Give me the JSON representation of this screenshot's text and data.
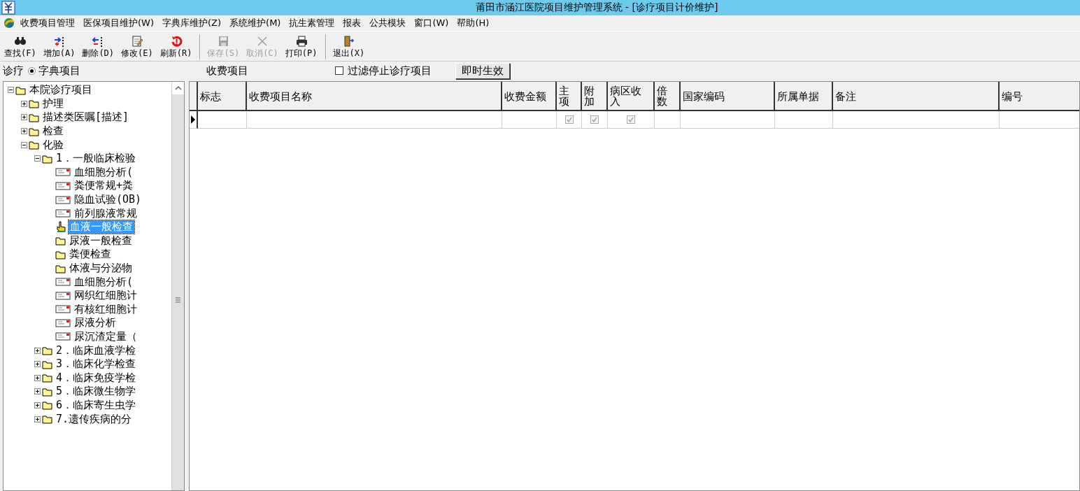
{
  "window": {
    "title": "莆田市涵江医院项目维护管理系统 - [诊疗项目计价维护]"
  },
  "menu": [
    {
      "label": "收费项目管理"
    },
    {
      "label": "医保项目维护(W)"
    },
    {
      "label": "字典库维护(Z)"
    },
    {
      "label": "系统维护(M)"
    },
    {
      "label": "抗生素管理"
    },
    {
      "label": "报表"
    },
    {
      "label": "公共模块"
    },
    {
      "label": "窗口(W)"
    },
    {
      "label": "帮助(H)"
    }
  ],
  "toolbar": [
    {
      "kind": "find",
      "label": "查找(F)",
      "disabled": false
    },
    {
      "kind": "add",
      "label": "增加(A)",
      "disabled": false
    },
    {
      "kind": "delete",
      "label": "删除(D)",
      "disabled": false
    },
    {
      "kind": "edit",
      "label": "修改(E)",
      "disabled": false
    },
    {
      "kind": "refresh",
      "label": "刷新(R)",
      "disabled": false
    },
    {
      "kind": "save",
      "label": "保存(S)",
      "disabled": true
    },
    {
      "kind": "cancel",
      "label": "取消(C)",
      "disabled": true
    },
    {
      "kind": "print",
      "label": "打印(P)",
      "disabled": false
    },
    {
      "kind": "exit",
      "label": "退出(X)",
      "disabled": false
    }
  ],
  "filter": {
    "prefix": "诊疗",
    "radio": {
      "label": "字典项目",
      "selected": true
    },
    "section_label": "收费项目",
    "checkbox": {
      "label": "过滤停止诊疗项目",
      "checked": false
    },
    "apply_button": "即时生效"
  },
  "tree": [
    {
      "kind": "branch",
      "label": "本院诊疗项目",
      "expanded": true,
      "selected": false,
      "children": [
        {
          "kind": "branch",
          "label": "护理",
          "expanded": false,
          "selected": false
        },
        {
          "kind": "branch",
          "label": "描述类医嘱[描述]",
          "expanded": false,
          "selected": false
        },
        {
          "kind": "branch",
          "label": "检查",
          "expanded": false,
          "selected": false
        },
        {
          "kind": "branch",
          "label": "化验",
          "expanded": true,
          "selected": false,
          "children": [
            {
              "kind": "branch",
              "label": "1．一般临床检验",
              "expanded": true,
              "selected": false,
              "children": [
                {
                  "kind": "document",
                  "label": "血细胞分析(",
                  "selected": false
                },
                {
                  "kind": "document",
                  "label": "粪便常规+粪",
                  "selected": false
                },
                {
                  "kind": "document",
                  "label": "隐血试验(OB)",
                  "selected": false
                },
                {
                  "kind": "document",
                  "label": "前列腺液常规",
                  "selected": false
                },
                {
                  "kind": "pointer",
                  "label": "血液一般检查",
                  "selected": true
                },
                {
                  "kind": "folder",
                  "label": "尿液一般检查",
                  "selected": false
                },
                {
                  "kind": "folder",
                  "label": "粪便检查",
                  "selected": false
                },
                {
                  "kind": "folder",
                  "label": "体液与分泌物",
                  "selected": false
                },
                {
                  "kind": "document",
                  "label": "血细胞分析(",
                  "selected": false
                },
                {
                  "kind": "document",
                  "label": "网织红细胞计",
                  "selected": false
                },
                {
                  "kind": "document",
                  "label": "有核红细胞计",
                  "selected": false
                },
                {
                  "kind": "document",
                  "label": "尿液分析",
                  "selected": false
                },
                {
                  "kind": "document",
                  "label": "尿沉渣定量（",
                  "selected": false
                }
              ]
            },
            {
              "kind": "branch",
              "label": "2．临床血液学检",
              "expanded": false,
              "selected": false
            },
            {
              "kind": "branch",
              "label": "3．临床化学检查",
              "expanded": false,
              "selected": false
            },
            {
              "kind": "branch",
              "label": "4．临床免疫学检",
              "expanded": false,
              "selected": false
            },
            {
              "kind": "branch",
              "label": "5．临床微生物学",
              "expanded": false,
              "selected": false
            },
            {
              "kind": "branch",
              "label": "6．临床寄生虫学",
              "expanded": false,
              "selected": false
            },
            {
              "kind": "branch",
              "label": "7.遗传疾病的分",
              "expanded": false,
              "selected": false
            }
          ]
        }
      ]
    }
  ],
  "table": {
    "columns": [
      "标志",
      "收费项目名称",
      "收费金额",
      "主项",
      "附加",
      "病区收入",
      "倍数",
      "国家编码",
      "所属单据",
      "备注",
      "编号"
    ],
    "rows": [
      {
        "current": true,
        "cells": [
          {
            "kind": "text",
            "text": ""
          },
          {
            "kind": "text",
            "text": ""
          },
          {
            "kind": "text",
            "text": ""
          },
          {
            "kind": "check",
            "checked": true,
            "disabled": true
          },
          {
            "kind": "check",
            "checked": true,
            "disabled": true
          },
          {
            "kind": "check",
            "checked": true,
            "disabled": true
          },
          {
            "kind": "text",
            "text": ""
          },
          {
            "kind": "text",
            "text": ""
          },
          {
            "kind": "text",
            "text": ""
          },
          {
            "kind": "text",
            "text": ""
          },
          {
            "kind": "text",
            "text": ""
          }
        ]
      }
    ]
  }
}
